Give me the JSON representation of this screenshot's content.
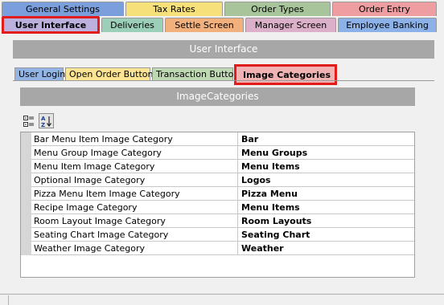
{
  "tabs_row1": [
    {
      "label": "General Settings",
      "color": "#7b9fdc"
    },
    {
      "label": "Tax Rates",
      "color": "#f6e07a"
    },
    {
      "label": "Order Types",
      "color": "#a8c49a"
    },
    {
      "label": "Order Entry",
      "color": "#ee9ea0"
    }
  ],
  "tabs_row2": [
    {
      "label": "User Interface",
      "color": "#bcb0de",
      "selected": true
    },
    {
      "label": "Deliveries",
      "color": "#9ccfb7"
    },
    {
      "label": "Settle Screen",
      "color": "#f2b07c"
    },
    {
      "label": "Manager Screen",
      "color": "#dcb0c8"
    },
    {
      "label": "Employee Banking",
      "color": "#8cb0e8"
    }
  ],
  "header": {
    "title": "User Interface"
  },
  "subtabs": [
    {
      "label": "User Login",
      "color": "#93b5e6"
    },
    {
      "label": "Open Order Buttons",
      "color": "#fbe493"
    },
    {
      "label": "Transaction Buttons",
      "color": "#bfd8b4"
    },
    {
      "label": "Image Categories",
      "color": "#f1b3b3",
      "selected": true
    }
  ],
  "section": {
    "title": "ImageCategories"
  },
  "toolbar": {
    "categorized_icon": "categorized-icon",
    "alphabetical_icon": "sort-az-icon"
  },
  "properties": [
    {
      "name": "Bar Menu Item Image Category",
      "value": "Bar"
    },
    {
      "name": "Menu Group Image Category",
      "value": "Menu Groups"
    },
    {
      "name": "Menu Item Image Category",
      "value": "Menu Items"
    },
    {
      "name": "Optional Image Category",
      "value": "Logos"
    },
    {
      "name": "Pizza Menu Item Image Category",
      "value": "Pizza Menu"
    },
    {
      "name": "Recipe Image Category",
      "value": "Menu Items"
    },
    {
      "name": "Room Layout Image Category",
      "value": "Room Layouts"
    },
    {
      "name": "Seating Chart Image Category",
      "value": "Seating Chart"
    },
    {
      "name": "Weather Image Category",
      "value": "Weather"
    }
  ]
}
